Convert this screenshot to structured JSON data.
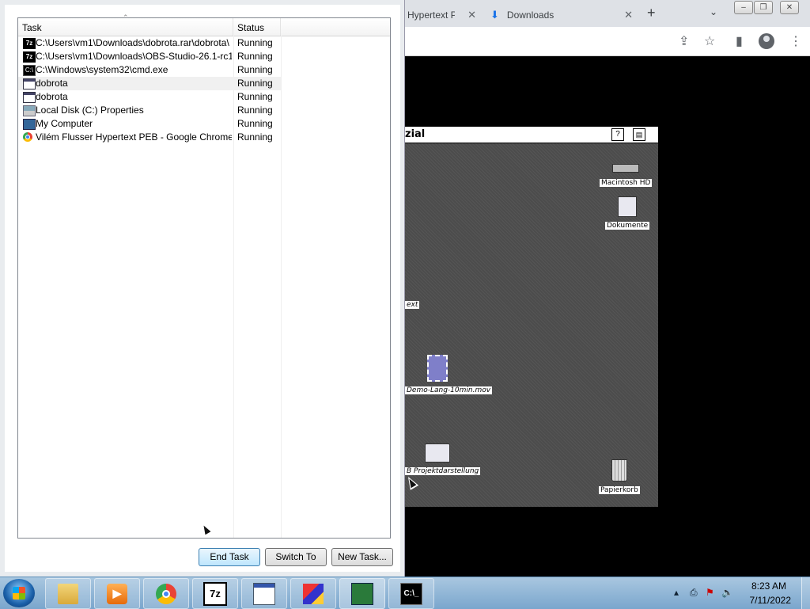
{
  "chrome": {
    "tab1_title": "Hypertext P",
    "tab2_title": "Downloads",
    "tab_close": "✕",
    "new_tab": "+",
    "tab_dropdown": "⌄",
    "win_minimize": "–",
    "win_restore": "❐",
    "win_close": "✕"
  },
  "mac": {
    "window_title": "zial",
    "help_icon_label": "?",
    "icons": {
      "macintosh_hd": "Macintosh HD",
      "dokumente": "Dokumente",
      "hypertext": "ext",
      "demo": "Demo-Lang-10min.mov",
      "projekt": "B Projektdarstellung",
      "trash": "Papierkorb"
    }
  },
  "taskmanager": {
    "columns": {
      "task": "Task",
      "status": "Status"
    },
    "rows": [
      {
        "icon": "7z",
        "task": "C:\\Users\\vm1\\Downloads\\dobrota.rar\\dobrota\\",
        "status": "Running"
      },
      {
        "icon": "7z",
        "task": "C:\\Users\\vm1\\Downloads\\OBS-Studio-26.1-rc1-...",
        "status": "Running"
      },
      {
        "icon": "cmd",
        "task": "C:\\Windows\\system32\\cmd.exe",
        "status": "Running"
      },
      {
        "icon": "window",
        "task": "dobrota",
        "status": "Running"
      },
      {
        "icon": "window",
        "task": "dobrota",
        "status": "Running"
      },
      {
        "icon": "disk",
        "task": "Local Disk (C:) Properties",
        "status": "Running"
      },
      {
        "icon": "computer",
        "task": "My Computer",
        "status": "Running"
      },
      {
        "icon": "chrome",
        "task": "Vilém Flusser Hypertext PEB - Google Chrome",
        "status": "Running"
      }
    ],
    "buttons": {
      "end_task": "End Task",
      "switch_to": "Switch To",
      "new_task": "New Task..."
    }
  },
  "taskbar": {
    "apps": [
      "windows-explorer",
      "media-player",
      "google-chrome",
      "7-zip",
      "application-window",
      "virtualbox",
      "task-manager",
      "command-prompt"
    ],
    "time": "8:23 AM",
    "date": "7/11/2022"
  }
}
